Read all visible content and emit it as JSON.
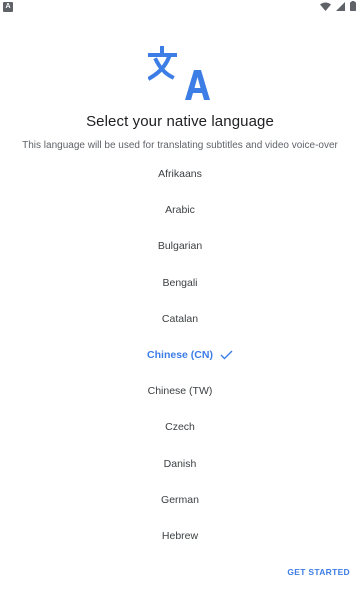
{
  "status_bar": {
    "app_icon_letter": "A",
    "icons": [
      "wifi-icon",
      "signal-icon",
      "battery-icon"
    ]
  },
  "logo": {
    "icon": "translate-icon",
    "glyph_left": "文",
    "glyph_right": "A",
    "color": "#3d7de6"
  },
  "title": "Select your native language",
  "subtitle": "This language will be used for translating subtitles and video voice-over",
  "languages": [
    {
      "label": "Afrikaans",
      "selected": false
    },
    {
      "label": "Arabic",
      "selected": false
    },
    {
      "label": "Bulgarian",
      "selected": false
    },
    {
      "label": "Bengali",
      "selected": false
    },
    {
      "label": "Catalan",
      "selected": false
    },
    {
      "label": "Chinese (CN)",
      "selected": true
    },
    {
      "label": "Chinese (TW)",
      "selected": false
    },
    {
      "label": "Czech",
      "selected": false
    },
    {
      "label": "Danish",
      "selected": false
    },
    {
      "label": "German",
      "selected": false
    },
    {
      "label": "Hebrew",
      "selected": false
    }
  ],
  "accent_color": "#3d7de6",
  "get_started_label": "GET STARTED"
}
